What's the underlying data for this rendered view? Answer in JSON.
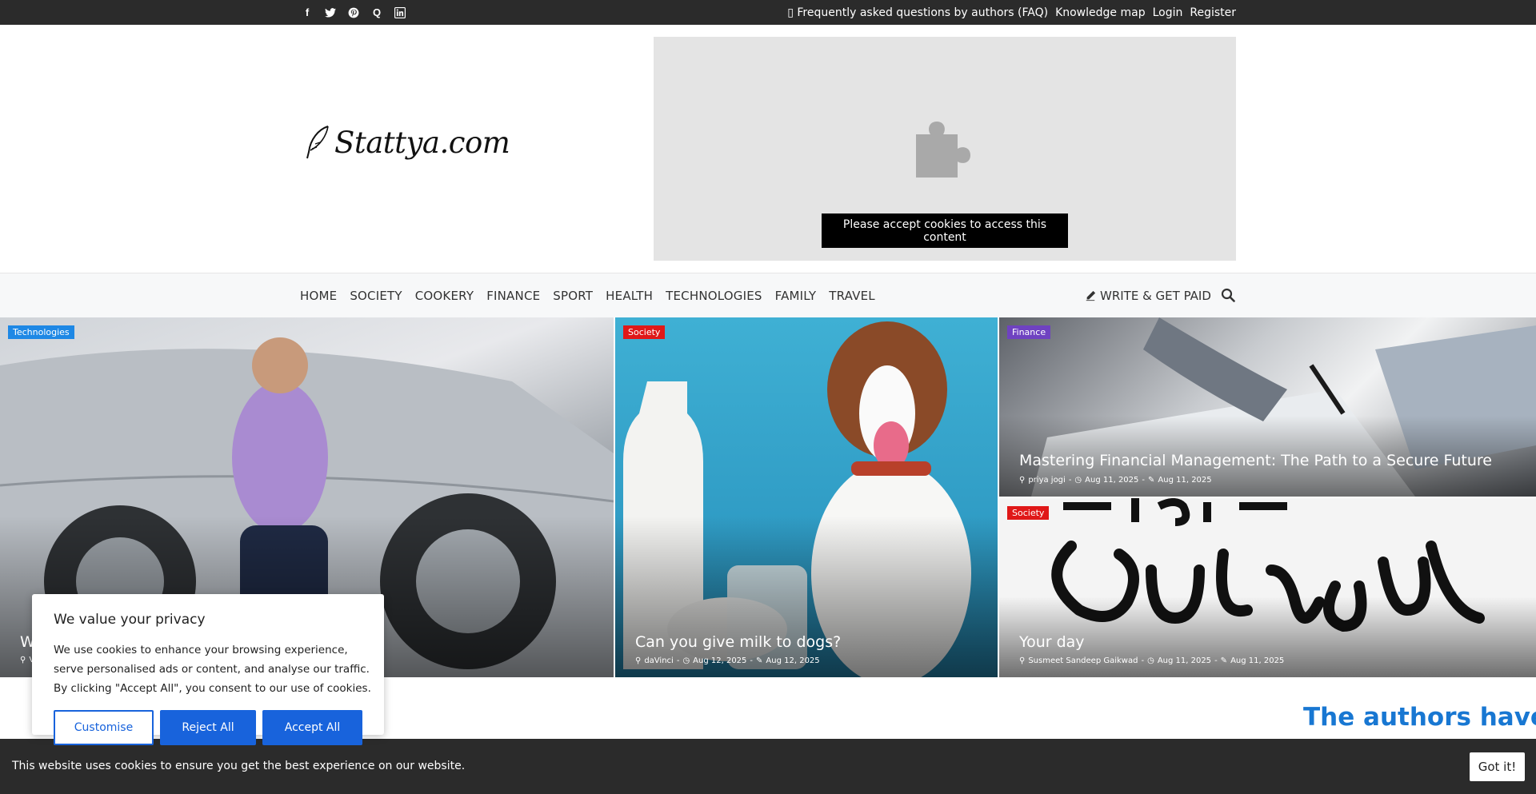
{
  "topbar": {
    "social_icons": [
      "facebook-icon",
      "twitter-icon",
      "pinterest-icon",
      "quora-icon",
      "linkedin-icon"
    ],
    "links": {
      "faq": "Frequently asked questions by authors (FAQ)",
      "knowledge_map": "Knowledge map",
      "login": "Login",
      "register": "Register"
    }
  },
  "header": {
    "logo": "Stattya.com",
    "ad_message": "Please accept cookies to access this content"
  },
  "nav": {
    "items": [
      "HOME",
      "SOCIETY",
      "COOKERY",
      "FINANCE",
      "SPORT",
      "HEALTH",
      "TECHNOLOGIES",
      "FAMILY",
      "TRAVEL"
    ],
    "write": "WRITE & GET PAID"
  },
  "cards": [
    {
      "category": "Technologies",
      "category_color": "#1e88e5",
      "title": "W",
      "author": "V"
    },
    {
      "category": "Society",
      "category_color": "#e01818",
      "title": "Can you give milk to dogs?",
      "author": "daVinci",
      "published": "Aug 12, 2025",
      "updated": "Aug 12, 2025"
    },
    {
      "category": "Finance",
      "category_color": "#6f42c1",
      "title": "Mastering Financial Management: The Path to a Secure Future",
      "author": "priya jogi",
      "published": "Aug 11, 2025",
      "updated": "Aug 11, 2025"
    },
    {
      "category": "Society",
      "category_color": "#e01818",
      "title": "Your day",
      "author": "Susmeet Sandeep Gaikwad",
      "published": "Aug 11, 2025",
      "updated": "Aug 11, 2025"
    }
  ],
  "headline": "The authors have alr",
  "privacy": {
    "title": "We value your privacy",
    "body": "We use cookies to enhance your browsing experience, serve personalised ads or content, and analyse our traffic. By clicking \"Accept All\", you consent to our use of cookies.",
    "customise": "Customise",
    "reject": "Reject All",
    "accept": "Accept All"
  },
  "cookiebar": {
    "message": "This website uses cookies to ensure you get the best experience on our website.",
    "got_it": "Got it!"
  }
}
